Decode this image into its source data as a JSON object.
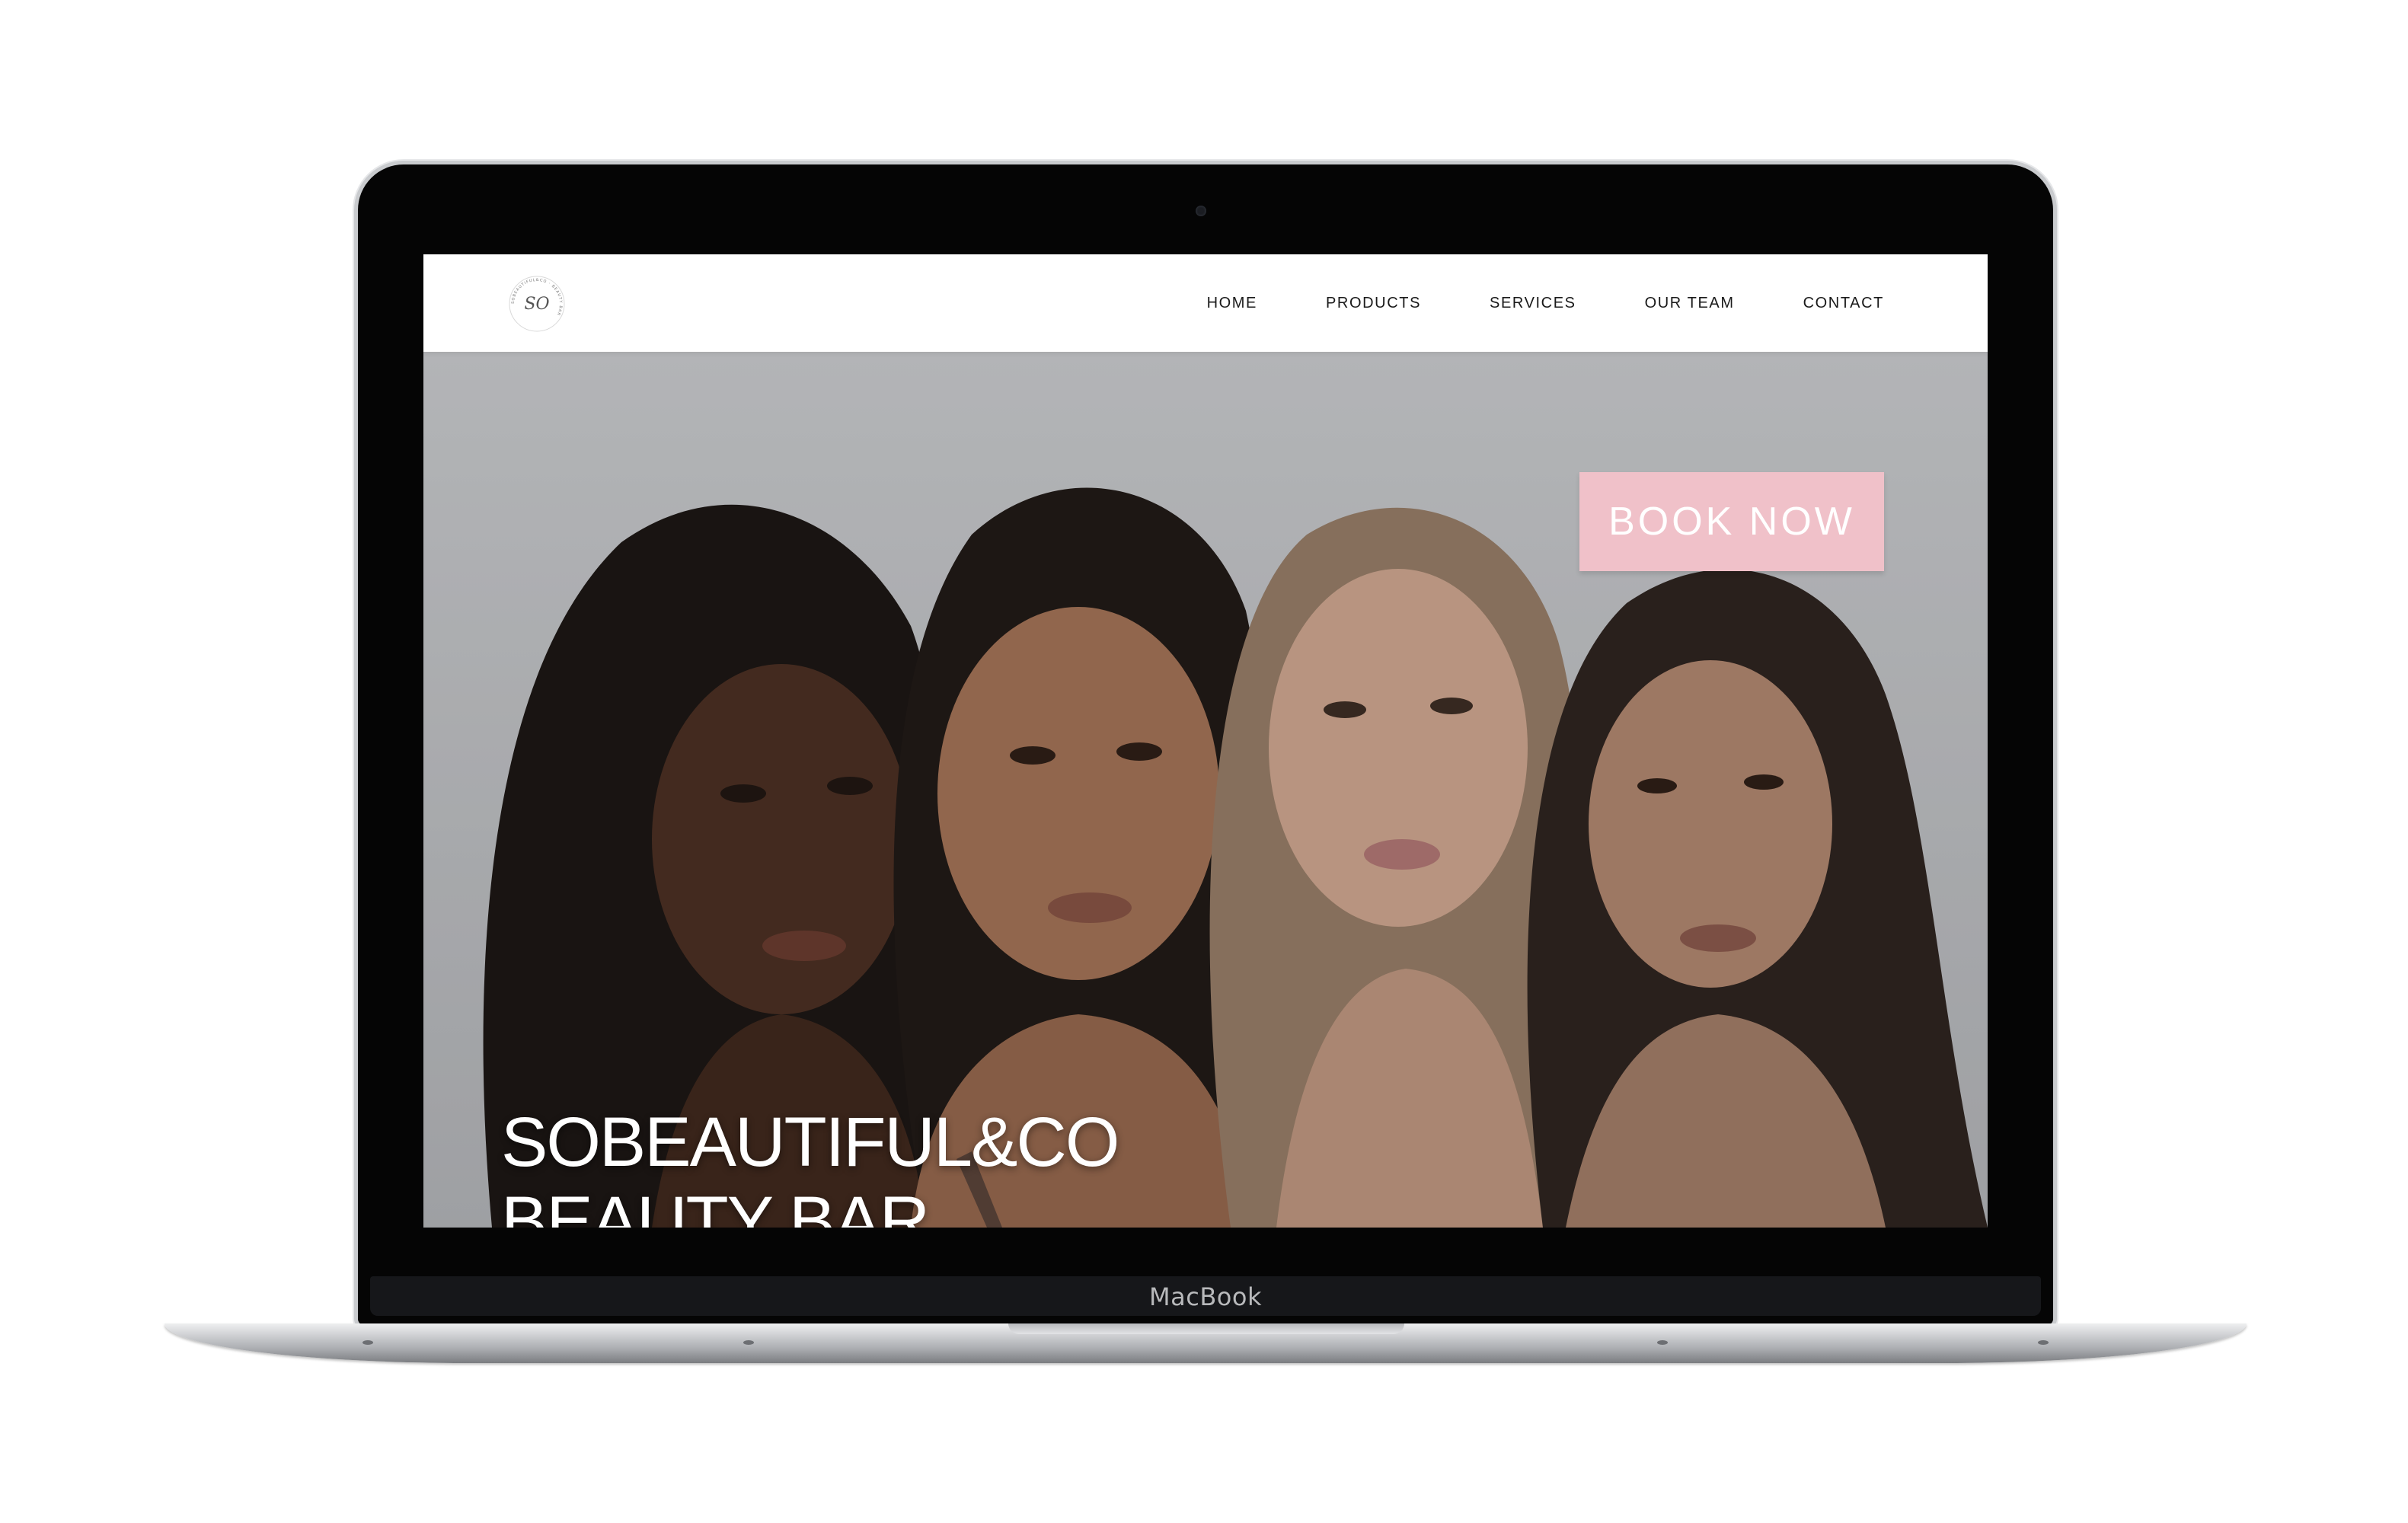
{
  "device": {
    "brand_label": "MacBook"
  },
  "site": {
    "logo": {
      "monogram": "SO",
      "ring_text": "SOBEAUTIFUL&CO · BEAUTY BAR"
    },
    "nav": {
      "items": [
        {
          "label": "HOME"
        },
        {
          "label": "PRODUCTS"
        },
        {
          "label": "SERVICES"
        },
        {
          "label": "OUR TEAM"
        },
        {
          "label": "CONTACT"
        }
      ]
    },
    "hero": {
      "cta_label": "BOOK NOW",
      "title_line1": "SOBEAUTIFUL&CO",
      "title_line2": "BEAUTY BAR",
      "image": "four-women-portrait"
    }
  },
  "colors": {
    "cta_background": "#f0c1c9",
    "header_background": "#ffffff",
    "device_frame": "#050505"
  }
}
